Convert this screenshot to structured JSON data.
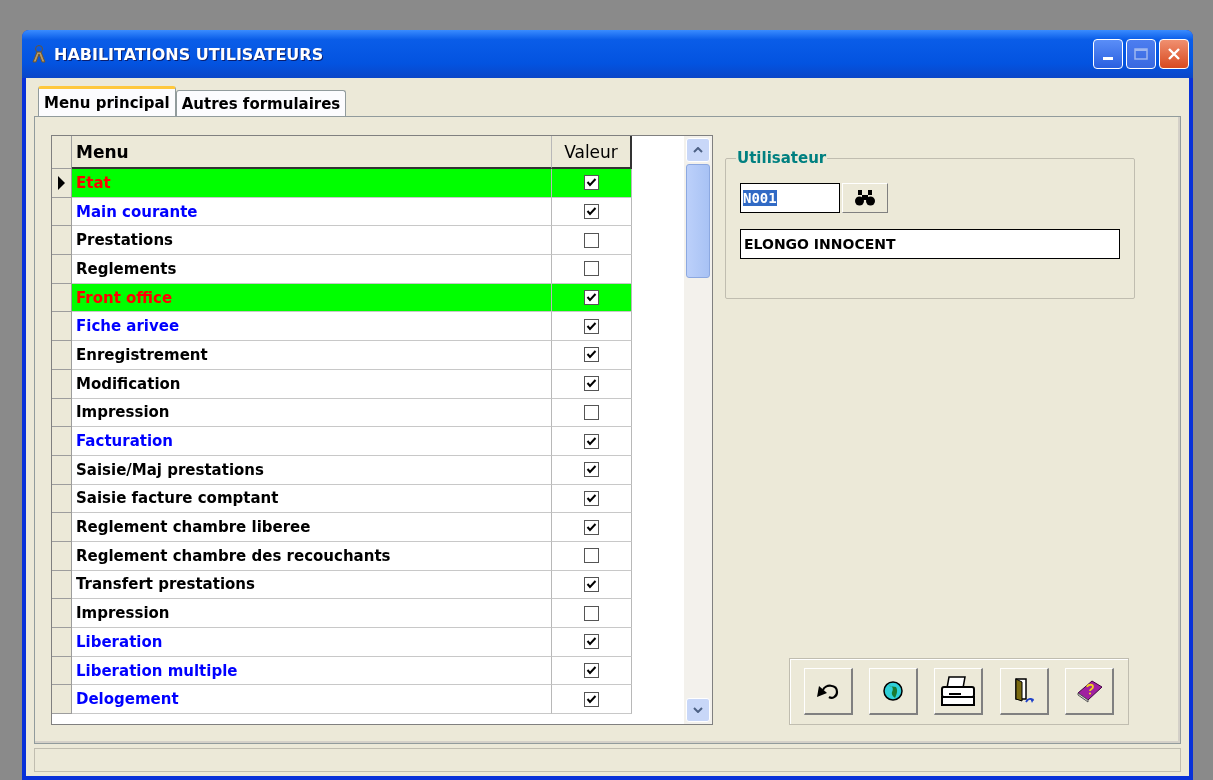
{
  "window": {
    "title": "HABILITATIONS UTILISATEURS"
  },
  "tabs": [
    {
      "label": "Menu principal",
      "selected": true
    },
    {
      "label": "Autres formulaires",
      "selected": false
    }
  ],
  "grid": {
    "columns": [
      "Menu",
      "Valeur"
    ],
    "rows": [
      {
        "label": "Etat",
        "kind": "menu",
        "checked": true,
        "selected": true
      },
      {
        "label": "Main courante",
        "kind": "submenu",
        "checked": true,
        "selected": false
      },
      {
        "label": "Prestations",
        "kind": "item",
        "checked": false,
        "selected": false
      },
      {
        "label": "Reglements",
        "kind": "item",
        "checked": false,
        "selected": false
      },
      {
        "label": "Front office",
        "kind": "menu",
        "checked": true,
        "selected": false
      },
      {
        "label": "Fiche arivee",
        "kind": "submenu",
        "checked": true,
        "selected": false
      },
      {
        "label": "Enregistrement",
        "kind": "item",
        "checked": true,
        "selected": false
      },
      {
        "label": "Modification",
        "kind": "item",
        "checked": true,
        "selected": false
      },
      {
        "label": "Impression",
        "kind": "item",
        "checked": false,
        "selected": false
      },
      {
        "label": "Facturation",
        "kind": "submenu",
        "checked": true,
        "selected": false
      },
      {
        "label": "Saisie/Maj prestations",
        "kind": "item",
        "checked": true,
        "selected": false
      },
      {
        "label": "Saisie facture comptant",
        "kind": "item",
        "checked": true,
        "selected": false
      },
      {
        "label": "Reglement chambre liberee",
        "kind": "item",
        "checked": true,
        "selected": false
      },
      {
        "label": "Reglement chambre des recouchants",
        "kind": "item",
        "checked": false,
        "selected": false
      },
      {
        "label": "Transfert prestations",
        "kind": "item",
        "checked": true,
        "selected": false
      },
      {
        "label": "Impression",
        "kind": "item",
        "checked": false,
        "selected": false
      },
      {
        "label": "Liberation",
        "kind": "submenu",
        "checked": true,
        "selected": false
      },
      {
        "label": "Liberation multiple",
        "kind": "submenu",
        "checked": true,
        "selected": false
      },
      {
        "label": "Delogement",
        "kind": "submenu",
        "checked": true,
        "selected": false
      }
    ]
  },
  "user": {
    "legend": "Utilisateur",
    "code": "N001",
    "name": "ELONGO INNOCENT"
  },
  "toolbar": [
    {
      "kind": "undo"
    },
    {
      "kind": "globe"
    },
    {
      "kind": "print"
    },
    {
      "kind": "exit"
    },
    {
      "kind": "help"
    }
  ]
}
